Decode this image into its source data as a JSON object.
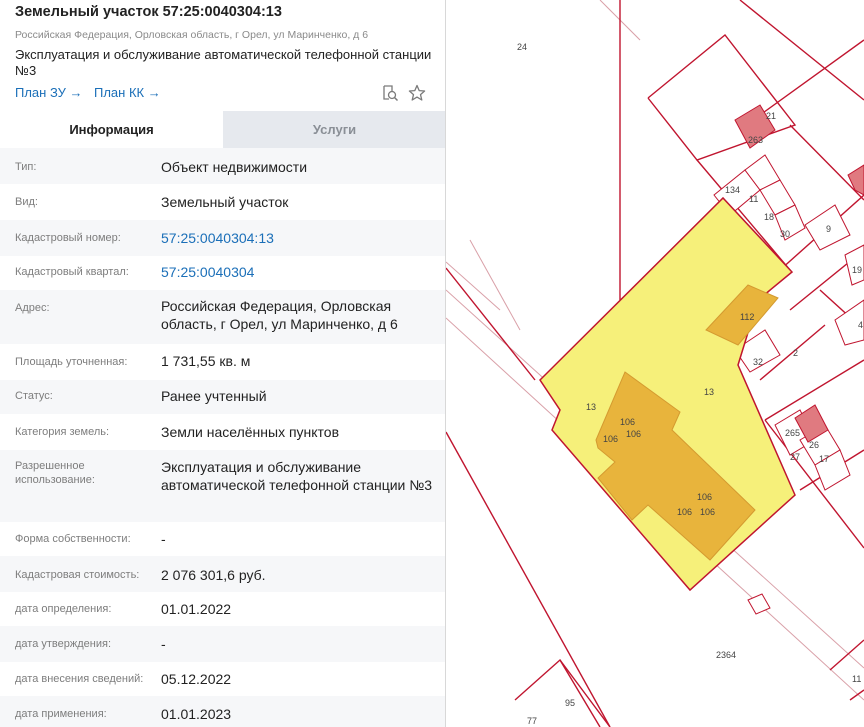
{
  "header": {
    "title": "Земельный участок 57:25:0040304:13",
    "subtitle": "Российская Федерация, Орловская область, г Орел, ул Маринченко, д 6",
    "usage_line1": "Эксплуатация и обслуживание автоматической телефонной станции",
    "usage_line2": "№3",
    "plan_zu": "План ЗУ →",
    "plan_kk": "План КК →",
    "icons": [
      "search-document-icon",
      "star-icon"
    ]
  },
  "tabs": [
    {
      "label": "Информация",
      "active": true
    },
    {
      "label": "Услуги",
      "active": false
    }
  ],
  "rows": [
    {
      "label": "Тип:",
      "value": "Объект недвижимости"
    },
    {
      "label": "Вид:",
      "value": "Земельный участок"
    },
    {
      "label": "Кадастровый номер:",
      "value": "57:25:0040304:13",
      "link": true
    },
    {
      "label": "Кадастровый квартал:",
      "value": "57:25:0040304",
      "link": true
    },
    {
      "label": "Адрес:",
      "value": "Российская Федерация, Орловская область, г Орел, ул Маринченко, д 6"
    },
    {
      "label": "Площадь уточненная:",
      "value": "1 731,55 кв. м"
    },
    {
      "label": "Статус:",
      "value": "Ранее учтенный"
    },
    {
      "label": "Категория земель:",
      "value": "Земли населённых пунктов"
    },
    {
      "label": "Разрешенное использование:",
      "value": "Эксплуатация и обслуживание автоматической телефонной станции №3"
    },
    {
      "label": "Форма собственности:",
      "value": "-"
    },
    {
      "label": "Кадастровая стоимость:",
      "value": "2 076 301,6 руб."
    },
    {
      "label": "дата определения:",
      "value": "01.01.2022"
    },
    {
      "label": "дата утверждения:",
      "value": "-"
    },
    {
      "label": "дата внесения сведений:",
      "value": "05.12.2022"
    },
    {
      "label": "дата применения:",
      "value": "01.01.2023"
    }
  ],
  "map": {
    "colors": {
      "parcel_border": "#c0152f",
      "selected_fill": "#f6f07a",
      "building_fill": "#e8b43c",
      "building_red": "#e07a80",
      "road_line": "#d9a0a8"
    },
    "labels": [
      "24",
      "21",
      "263",
      "134",
      "11",
      "18",
      "30",
      "9",
      "19",
      "112",
      "32",
      "2",
      "4",
      "13",
      "13",
      "106",
      "106",
      "106",
      "106",
      "106",
      "106",
      "265",
      "26",
      "27",
      "17",
      "2364",
      "95",
      "77",
      "11"
    ]
  }
}
